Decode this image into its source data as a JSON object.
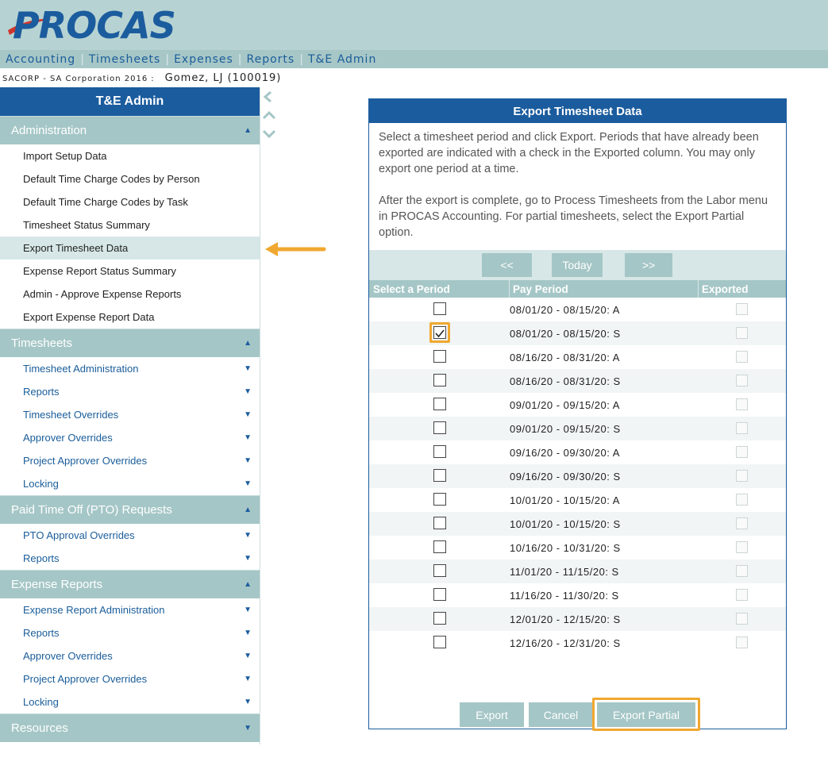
{
  "brand": {
    "logo_text": "PROCAS",
    "reg_mark": "®",
    "blue": "#1b5c9e",
    "red": "#d0342c"
  },
  "topnav": [
    "Accounting",
    "Timesheets",
    "Expenses",
    "Reports",
    "T&E Admin"
  ],
  "company": {
    "name": "SACORP - SA Corporation 2016",
    "separator": ":",
    "user": "Gomez, LJ (100019)"
  },
  "sidebar": {
    "title": "T&E Admin",
    "administration": {
      "label": "Administration",
      "items": [
        "Import Setup Data",
        "Default Time Charge Codes by Person",
        "Default Time Charge Codes by Task",
        "Timesheet Status Summary",
        "Export Timesheet Data",
        "Expense Report Status Summary",
        "Admin - Approve Expense Reports",
        "Export Expense Report Data"
      ]
    },
    "timesheets": {
      "label": "Timesheets",
      "items": [
        "Timesheet Administration",
        "Reports",
        "Timesheet Overrides",
        "Approver Overrides",
        "Project Approver Overrides",
        "Locking"
      ]
    },
    "pto": {
      "label": "Paid Time Off (PTO) Requests",
      "items": [
        "PTO Approval Overrides",
        "Reports"
      ]
    },
    "expense": {
      "label": "Expense Reports",
      "items": [
        "Expense Report Administration",
        "Reports",
        "Approver Overrides",
        "Project Approver Overrides",
        "Locking"
      ]
    },
    "resources": {
      "label": "Resources"
    }
  },
  "panel": {
    "title": "Export Timesheet Data",
    "desc1": "Select a timesheet period and click Export. Periods that have already been exported are indicated with a check in the Exported column. You may only export one period at a time.",
    "desc2": "After the export is complete, go to Process Timesheets from the Labor menu in PROCAS Accounting. For partial timesheets, select the Export Partial option.",
    "nav": {
      "prev": "<<",
      "today": "Today",
      "next": ">>"
    },
    "columns": {
      "select": "Select a Period",
      "period": "Pay Period",
      "exported": "Exported"
    },
    "rows": [
      {
        "period": "08/01/20 - 08/15/20: A",
        "selected": false
      },
      {
        "period": "08/01/20 - 08/15/20: S",
        "selected": true
      },
      {
        "period": "08/16/20 - 08/31/20: A",
        "selected": false
      },
      {
        "period": "08/16/20 - 08/31/20: S",
        "selected": false
      },
      {
        "period": "09/01/20 - 09/15/20: A",
        "selected": false
      },
      {
        "period": "09/01/20 - 09/15/20: S",
        "selected": false
      },
      {
        "period": "09/16/20 - 09/30/20: A",
        "selected": false
      },
      {
        "period": "09/16/20 - 09/30/20: S",
        "selected": false
      },
      {
        "period": "10/01/20 - 10/15/20: A",
        "selected": false
      },
      {
        "period": "10/01/20 - 10/15/20: S",
        "selected": false
      },
      {
        "period": "10/16/20 - 10/31/20: S",
        "selected": false
      },
      {
        "period": "11/01/20 - 11/15/20: S",
        "selected": false
      },
      {
        "period": "11/16/20 - 11/30/20: S",
        "selected": false
      },
      {
        "period": "12/01/20 - 12/15/20: S",
        "selected": false
      },
      {
        "period": "12/16/20 - 12/31/20: S",
        "selected": false
      }
    ],
    "buttons": {
      "export": "Export",
      "cancel": "Cancel",
      "export_partial": "Export Partial"
    }
  },
  "colors": {
    "highlight": "#f0a830",
    "teal": "#a5c6c6",
    "header_bg": "#b6d2d2"
  }
}
